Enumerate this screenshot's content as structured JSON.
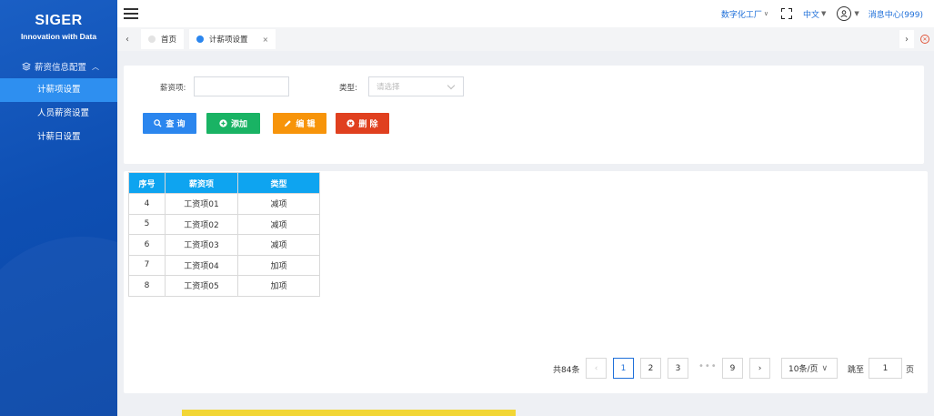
{
  "brand": {
    "name": "SIGER",
    "tagline": "Innovation with Data"
  },
  "sidebar": {
    "group": {
      "label": "薪资信息配置",
      "icon": "layers-icon"
    },
    "items": [
      {
        "label": "计薪项设置",
        "active": true
      },
      {
        "label": "人员薪资设置",
        "active": false
      },
      {
        "label": "计薪日设置",
        "active": false
      }
    ]
  },
  "header": {
    "factory": "数字化工厂",
    "language": "中文",
    "messages": "消息中心(999)"
  },
  "tabs": {
    "home": "首页",
    "current": "计薪项设置",
    "close_symbol": "×"
  },
  "search": {
    "salary_item_label": "薪资项:",
    "salary_item_value": "",
    "type_label": "类型:",
    "type_placeholder": "请选择",
    "buttons": {
      "query": "查 询",
      "add": "添加",
      "edit": "编 辑",
      "delete": "删 除"
    }
  },
  "colors": {
    "query": "#2b86ee",
    "add": "#19b364",
    "edit": "#f7940a",
    "delete": "#e0401f",
    "table_header": "#0ea4f0"
  },
  "table": {
    "headers": [
      "序号",
      "薪资项",
      "类型"
    ],
    "rows": [
      [
        "4",
        "工资项01",
        "减项"
      ],
      [
        "5",
        "工资项02",
        "减项"
      ],
      [
        "6",
        "工资项03",
        "减项"
      ],
      [
        "7",
        "工资项04",
        "加项"
      ],
      [
        "8",
        "工资项05",
        "加项"
      ]
    ]
  },
  "pagination": {
    "total": "共84条",
    "pages": [
      "1",
      "2",
      "3"
    ],
    "last": "9",
    "current": "1",
    "page_size": "10条/页",
    "jump_label": "跳至",
    "jump_value": "1",
    "jump_suffix": "页"
  }
}
